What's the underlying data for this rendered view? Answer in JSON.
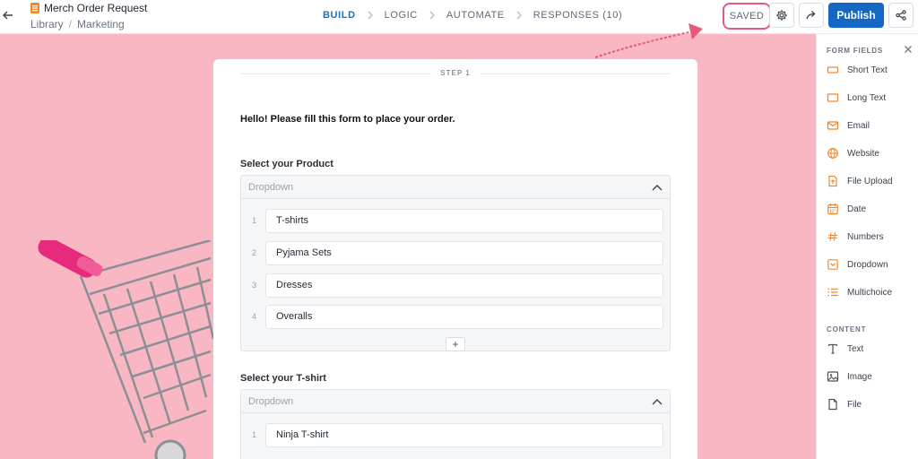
{
  "header": {
    "form_title": "Merch Order Request",
    "breadcrumb": [
      "Library",
      "Marketing"
    ],
    "steps": [
      {
        "label": "BUILD",
        "active": true
      },
      {
        "label": "LOGIC",
        "active": false
      },
      {
        "label": "AUTOMATE",
        "active": false
      },
      {
        "label": "RESPONSES (10)",
        "active": false
      }
    ],
    "saved_label": "SAVED",
    "publish_label": "Publish"
  },
  "card": {
    "step_label": "STEP 1",
    "intro": "Hello! Please fill this form to place your order.",
    "questions": [
      {
        "label": "Select your Product",
        "placeholder": "Dropdown",
        "options": [
          "T-shirts",
          "Pyjama Sets",
          "Dresses",
          "Overalls"
        ]
      },
      {
        "label": "Select your T-shirt",
        "placeholder": "Dropdown",
        "options": [
          "Ninja T-shirt"
        ]
      }
    ],
    "add_option_label": "+"
  },
  "panel": {
    "form_fields_heading": "FORM FIELDS",
    "form_fields": [
      {
        "label": "Short Text",
        "icon": "short-text-icon"
      },
      {
        "label": "Long Text",
        "icon": "long-text-icon"
      },
      {
        "label": "Email",
        "icon": "email-icon"
      },
      {
        "label": "Website",
        "icon": "globe-icon"
      },
      {
        "label": "File Upload",
        "icon": "file-upload-icon"
      },
      {
        "label": "Date",
        "icon": "calendar-icon"
      },
      {
        "label": "Numbers",
        "icon": "numbers-icon"
      },
      {
        "label": "Dropdown",
        "icon": "dropdown-icon"
      },
      {
        "label": "Multichoice",
        "icon": "multichoice-icon"
      }
    ],
    "content_heading": "CONTENT",
    "content_items": [
      {
        "label": "Text",
        "icon": "text-icon"
      },
      {
        "label": "Image",
        "icon": "image-icon"
      },
      {
        "label": "File",
        "icon": "file-icon"
      }
    ]
  },
  "colors": {
    "accent": "#1567c4",
    "field_icon": "#f0862b",
    "canvas_bg": "#f9b7c3",
    "highlight": "#e8587c"
  }
}
